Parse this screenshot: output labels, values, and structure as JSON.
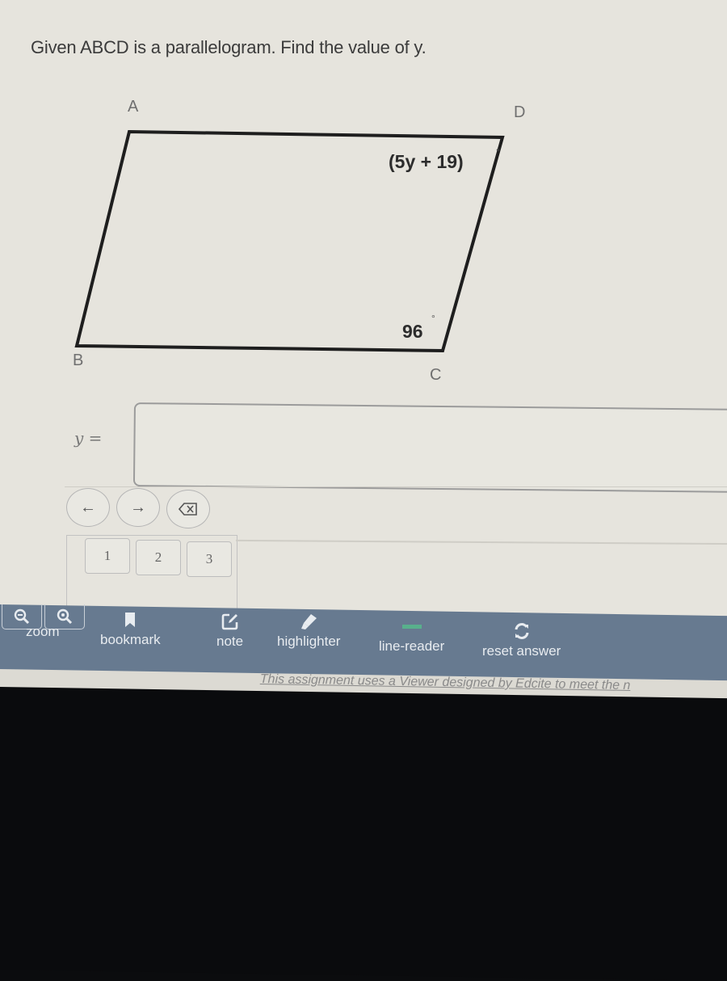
{
  "question": {
    "text": "Given ABCD is a parallelogram.  Find the value of y."
  },
  "figure": {
    "shape": "parallelogram",
    "vertices": {
      "A": "A",
      "B": "B",
      "C": "C",
      "D": "D"
    },
    "angle_D": {
      "expression": "(5y + 19)",
      "unit": "°"
    },
    "angle_C": {
      "value": "96",
      "unit": "°"
    }
  },
  "answer": {
    "label": "y =",
    "value": "",
    "placeholder": ""
  },
  "keypad": {
    "nav": [
      {
        "name": "cursor-left",
        "glyph": "←"
      },
      {
        "name": "cursor-right",
        "glyph": "→"
      },
      {
        "name": "backspace",
        "glyph": "⌫"
      }
    ],
    "keys": [
      "1",
      "2",
      "3"
    ]
  },
  "toolbar": {
    "zoom_label": "zoom",
    "zoom_out_icon": "zoom-out-icon",
    "zoom_in_icon": "zoom-in-icon",
    "bookmark_label": "bookmark",
    "note_label": "note",
    "highlighter_label": "highlighter",
    "line_reader_label": "line-reader",
    "reset_label": "reset answer",
    "bar_color": "#677a90"
  },
  "footer": {
    "text": "This assignment uses a Viewer designed by Edcite to meet the n"
  }
}
